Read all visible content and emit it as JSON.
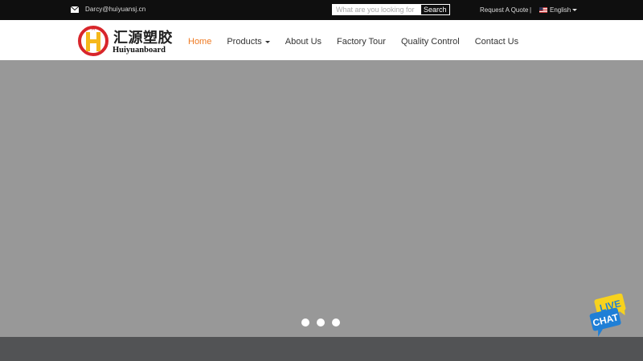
{
  "topbar": {
    "email": "Darcy@huiyuansj.cn",
    "search_placeholder": "What are you looking for",
    "search_button": "Search",
    "request_quote": "Request A Quote",
    "divider": "|",
    "language": "English"
  },
  "header": {
    "logo_cn": "汇源塑胶",
    "logo_en": "Huiyuanboard",
    "nav": {
      "home": "Home",
      "products": "Products",
      "about": "About Us",
      "factory": "Factory Tour",
      "quality": "Quality Control",
      "contact": "Contact Us"
    }
  },
  "colors": {
    "accent": "#ef7a22",
    "topbar_bg": "#0f0f0f",
    "hero_bg": "#989898",
    "footer_bg": "#525355",
    "chat_blue": "#1f7fd6",
    "chat_yellow": "#f7d21e"
  },
  "slider": {
    "slide_count": 3
  },
  "chat": {
    "line1": "LIVE",
    "line2": "CHAT"
  }
}
